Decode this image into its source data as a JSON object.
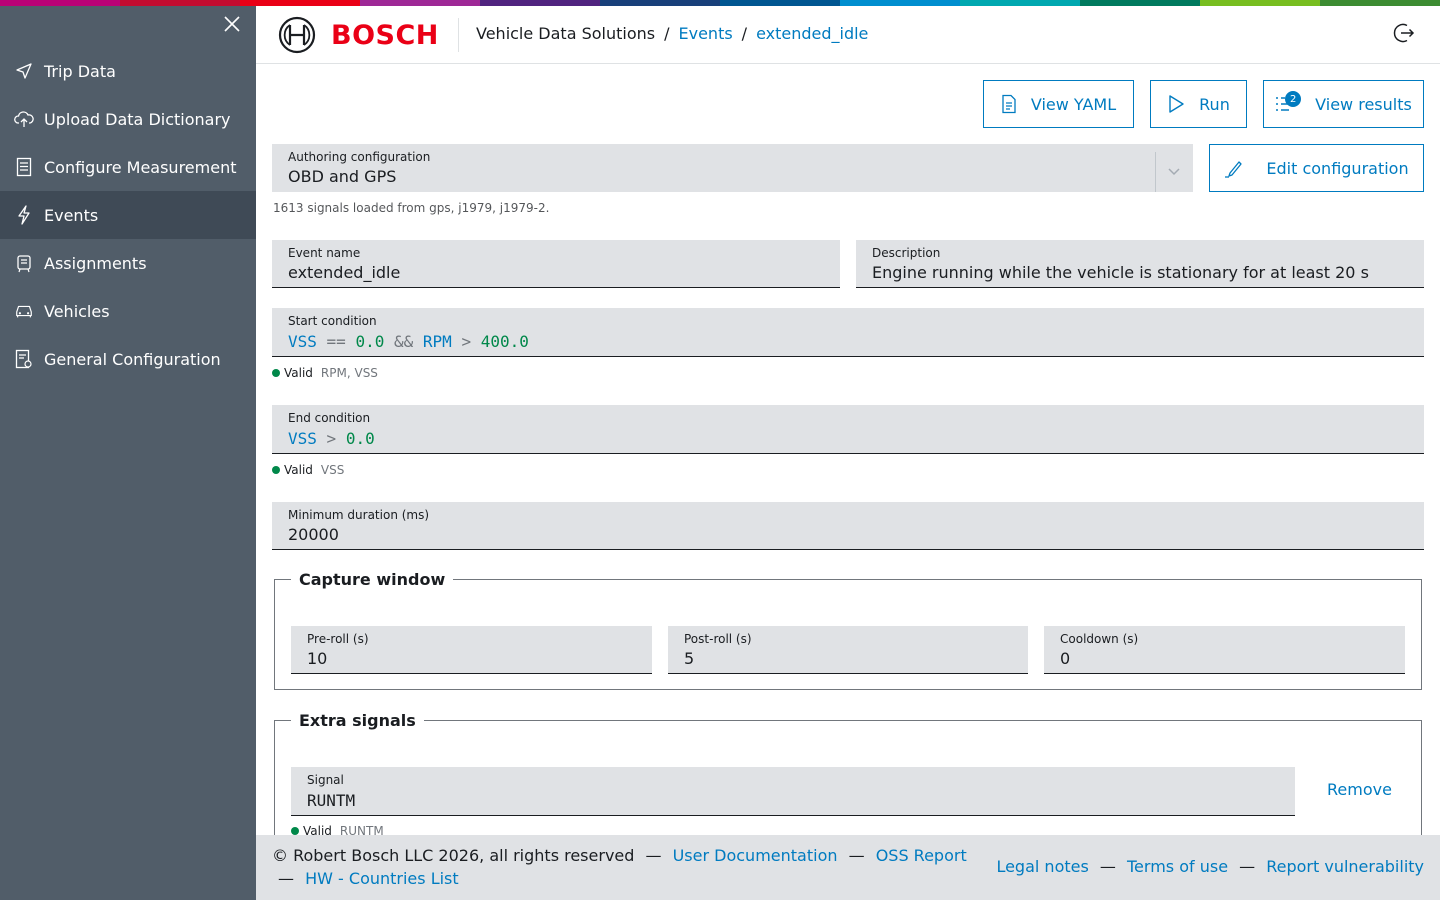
{
  "supergraphic_colors": [
    "#b90276",
    "#c20c30",
    "#ea0016",
    "#9e2896",
    "#50237f",
    "#18407a",
    "#005691",
    "#008ecf",
    "#00a8b0",
    "#007a5e",
    "#78be20",
    "#3c8c32"
  ],
  "sidebar": {
    "close_icon": "close-icon",
    "items": [
      {
        "label": "Trip Data",
        "icon": "navigation-icon"
      },
      {
        "label": "Upload Data Dictionary",
        "icon": "cloud-upload-icon"
      },
      {
        "label": "Configure Measurement",
        "icon": "document-list-icon"
      },
      {
        "label": "Events",
        "icon": "lightning-icon",
        "active": true
      },
      {
        "label": "Assignments",
        "icon": "assignment-icon"
      },
      {
        "label": "Vehicles",
        "icon": "car-icon"
      },
      {
        "label": "General Configuration",
        "icon": "settings-document-icon"
      }
    ]
  },
  "header": {
    "brand": "BOSCH",
    "breadcrumb": {
      "root": "Vehicle Data Solutions",
      "section": "Events",
      "current": "extended_idle",
      "separator": "/"
    },
    "logout_icon": "logout-icon"
  },
  "toolbar": {
    "view_yaml": "View YAML",
    "run": "Run",
    "view_results": "View results",
    "results_badge": "2"
  },
  "authoring": {
    "label": "Authoring configuration",
    "value": "OBD and GPS",
    "helper": "1613 signals loaded from gps, j1979, j1979-2.",
    "edit_button": "Edit configuration"
  },
  "event_name": {
    "label": "Event name",
    "value": "extended_idle"
  },
  "description": {
    "label": "Description",
    "value": "Engine running while the vehicle is stationary for at least 20 s"
  },
  "start_condition": {
    "label": "Start condition",
    "tokens": {
      "s1": "VSS",
      "o1": "==",
      "n1": "0.0",
      "o2": "&&",
      "s2": "RPM",
      "o3": ">",
      "n2": "400.0"
    },
    "status": "Valid",
    "signals": "RPM, VSS"
  },
  "end_condition": {
    "label": "End condition",
    "tokens": {
      "s1": "VSS",
      "o1": ">",
      "n1": "0.0"
    },
    "status": "Valid",
    "signals": "VSS"
  },
  "min_duration": {
    "label": "Minimum duration (ms)",
    "value": "20000"
  },
  "capture_window": {
    "title": "Capture window",
    "pre_roll": {
      "label": "Pre-roll (s)",
      "value": "10"
    },
    "post_roll": {
      "label": "Post-roll (s)",
      "value": "5"
    },
    "cooldown": {
      "label": "Cooldown (s)",
      "value": "0"
    }
  },
  "extra_signals": {
    "title": "Extra signals",
    "signal": {
      "label": "Signal",
      "value": "RUNTM",
      "status": "Valid",
      "signals": "RUNTM"
    },
    "remove": "Remove"
  },
  "footer": {
    "copyright": "© Robert Bosch LLC 2026, all rights reserved",
    "dash": "—",
    "user_docs": "User Documentation",
    "oss_report": "OSS Report",
    "hw_countries": "HW - Countries List",
    "legal_notes": "Legal notes",
    "terms": "Terms of use",
    "report_vuln": "Report vulnerability"
  }
}
